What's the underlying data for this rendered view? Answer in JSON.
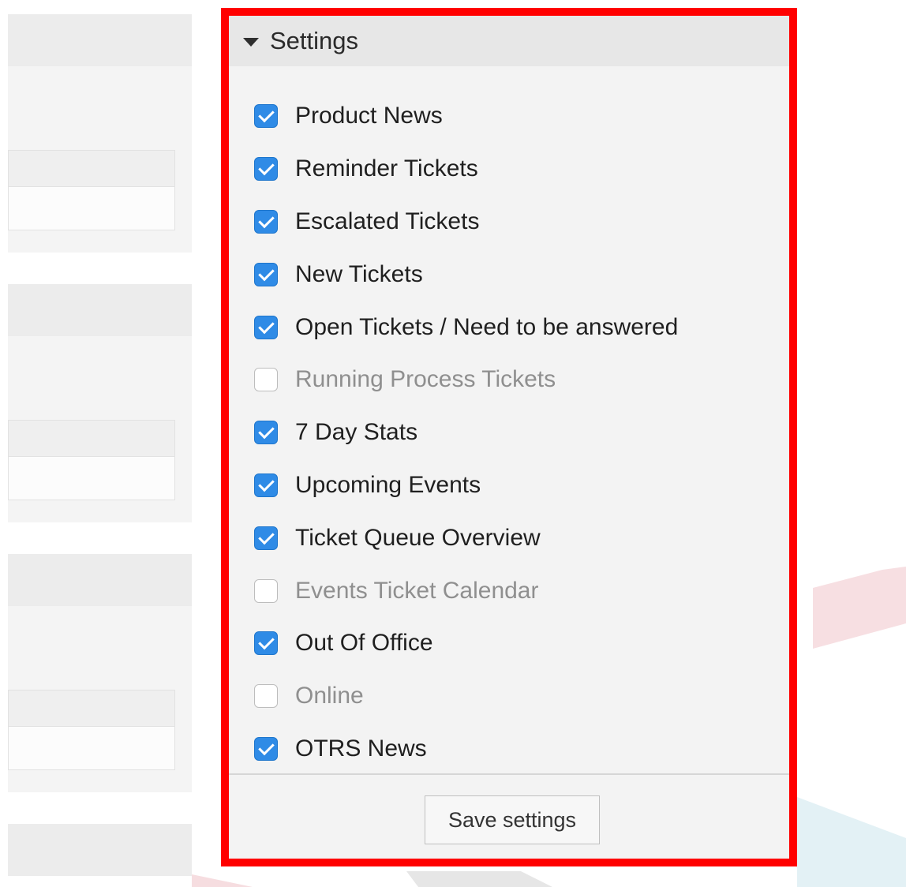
{
  "settings_panel": {
    "title": "Settings",
    "options": [
      {
        "label": "Product News",
        "checked": true
      },
      {
        "label": "Reminder Tickets",
        "checked": true
      },
      {
        "label": "Escalated Tickets",
        "checked": true
      },
      {
        "label": "New Tickets",
        "checked": true
      },
      {
        "label": "Open Tickets / Need to be answered",
        "checked": true
      },
      {
        "label": "Running Process Tickets",
        "checked": false
      },
      {
        "label": "7 Day Stats",
        "checked": true
      },
      {
        "label": "Upcoming Events",
        "checked": true
      },
      {
        "label": "Ticket Queue Overview",
        "checked": true
      },
      {
        "label": "Events Ticket Calendar",
        "checked": false
      },
      {
        "label": "Out Of Office",
        "checked": true
      },
      {
        "label": "Online",
        "checked": false
      },
      {
        "label": "OTRS News",
        "checked": true
      }
    ],
    "save_label": "Save settings"
  },
  "colors": {
    "highlight_border": "#ff0000",
    "checkbox_checked": "#2f8be6"
  }
}
